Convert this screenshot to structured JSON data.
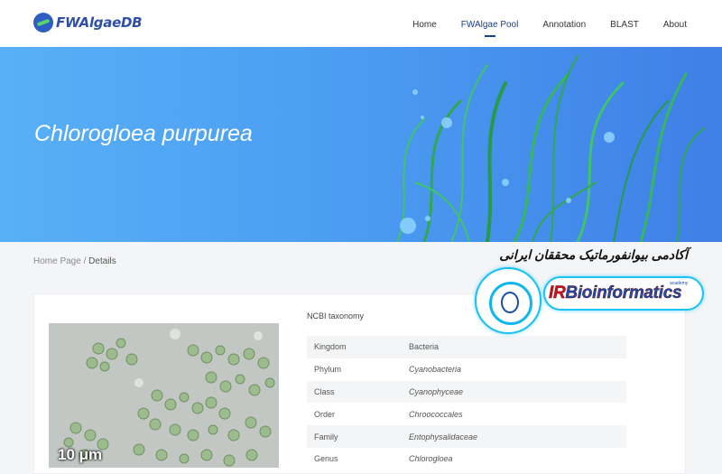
{
  "nav": {
    "logo_text": "FWAlgaeDB",
    "items": [
      {
        "label": "Home",
        "active": false
      },
      {
        "label": "FWAlgae Pool",
        "active": true
      },
      {
        "label": "Annotation",
        "active": false
      },
      {
        "label": "BLAST",
        "active": false
      },
      {
        "label": "About",
        "active": false
      }
    ]
  },
  "hero": {
    "title": "Chlorogloea purpurea"
  },
  "breadcrumb": {
    "home": "Home Page",
    "separator": " / ",
    "current": "Details"
  },
  "detail": {
    "scale_label": "10 μm",
    "taxonomy_heading": "NCBI taxonomy",
    "taxonomy": [
      {
        "rank": "Kingdom",
        "value": "Bacteria"
      },
      {
        "rank": "Phylum",
        "value": "Cyanobacteria"
      },
      {
        "rank": "Class",
        "value": "Cyanophyceae"
      },
      {
        "rank": "Order",
        "value": "Chroococcales"
      },
      {
        "rank": "Family",
        "value": "Entophysalidaceae"
      },
      {
        "rank": "Genus",
        "value": "Chlorogloea"
      }
    ]
  },
  "watermark": {
    "persian_text": "آکادمی بیوانفورماتیک محققان ایرانی",
    "brand_ir": "IR",
    "brand_rest": "Bioinformatics",
    "brand_sub": "academy"
  },
  "colors": {
    "nav_active": "#1a3f8a",
    "hero_start": "#58b0f6",
    "hero_end": "#3f7fe6",
    "algae_green": "#2fa84f"
  }
}
